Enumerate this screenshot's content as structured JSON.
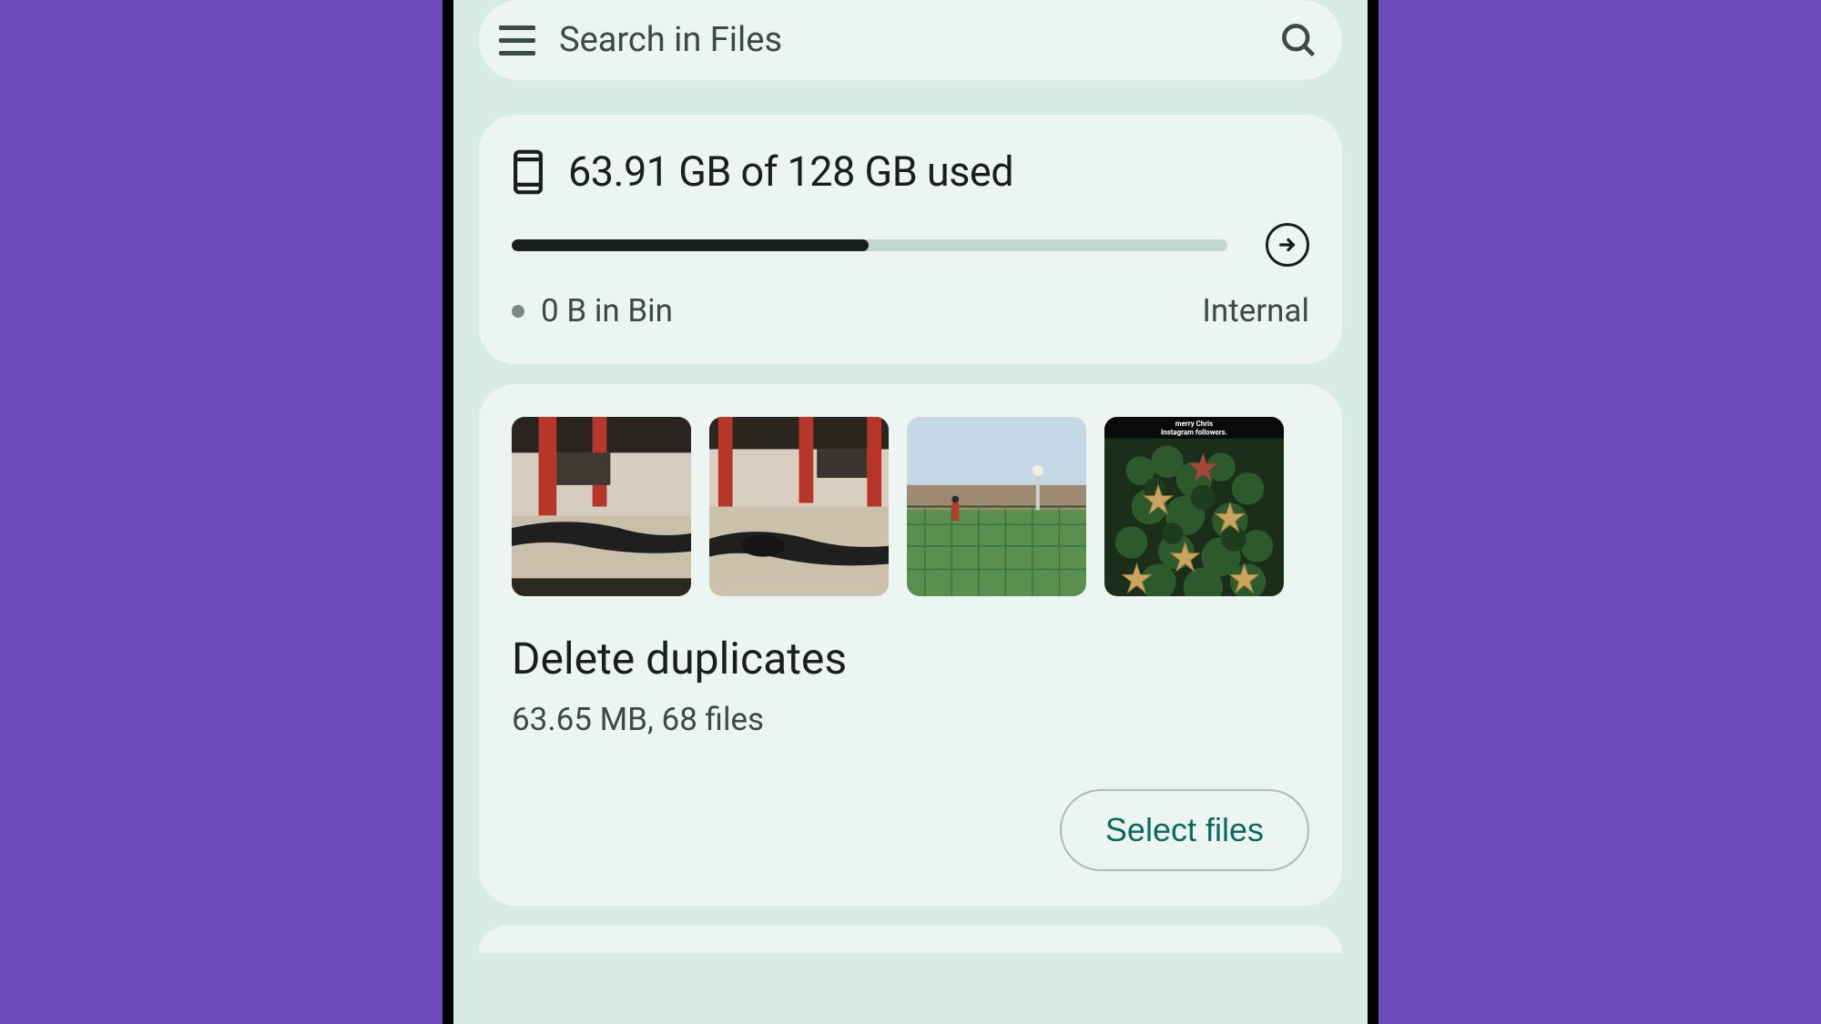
{
  "search": {
    "placeholder": "Search in Files"
  },
  "storage": {
    "headline": "63.91 GB of 128 GB used",
    "bin_text": "0 B in Bin",
    "location": "Internal",
    "progress_percent": 49.9
  },
  "duplicates": {
    "title": "Delete duplicates",
    "subtitle": "63.65 MB, 68 files",
    "action_label": "Select files",
    "thumbnails": [
      "go-kart-track-photo-1",
      "go-kart-track-photo-2",
      "football-pitch-photo",
      "christmas-tree-story"
    ],
    "thumbnail_overlay_text": {
      "line1": "merry Chris",
      "line2": "Instagram followers."
    }
  }
}
